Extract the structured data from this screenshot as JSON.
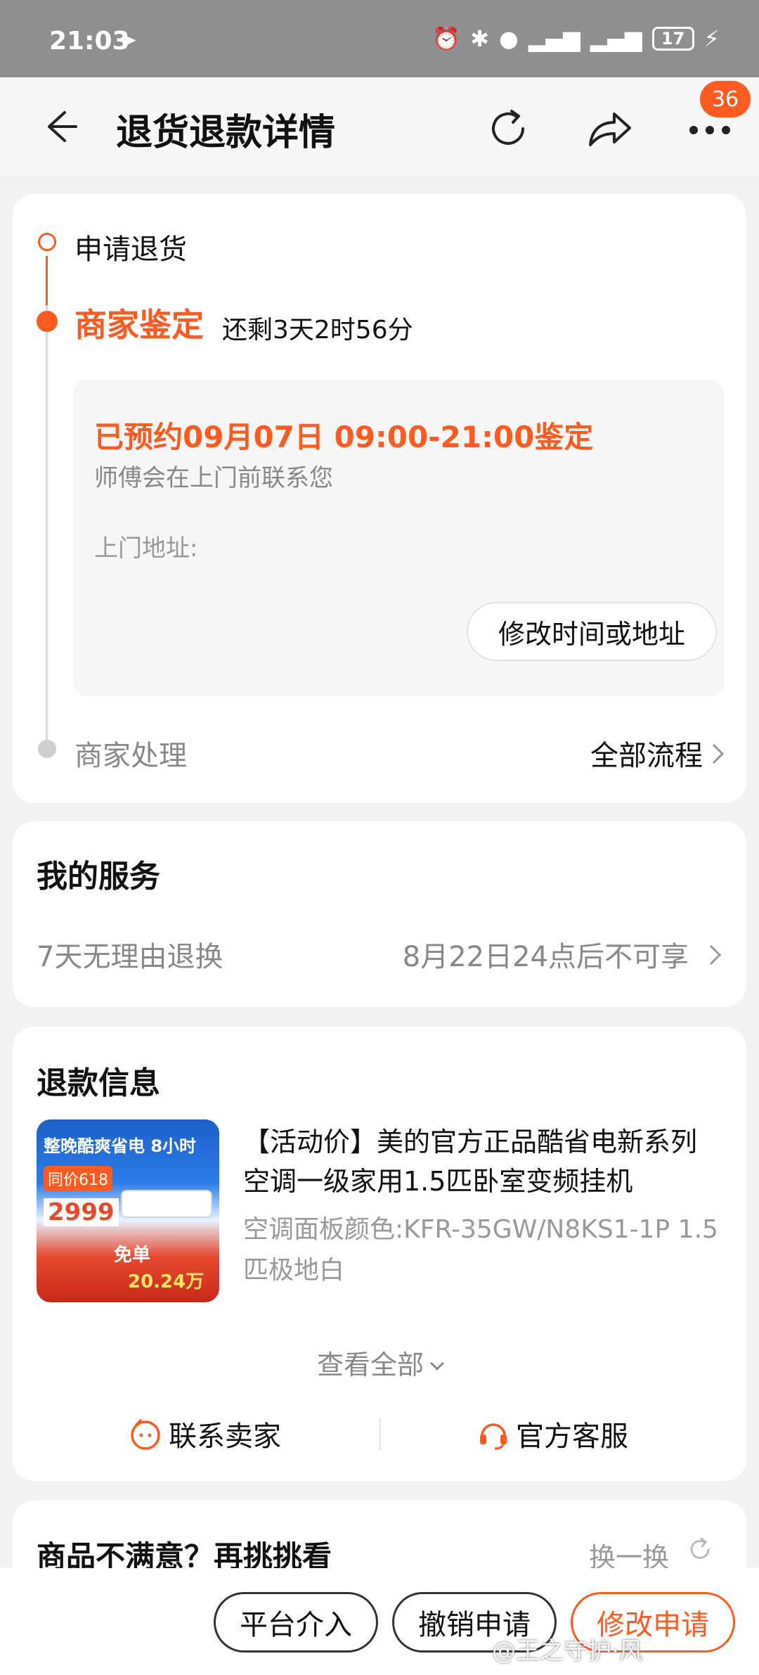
{
  "status_bar": {
    "time": "21:03",
    "battery": "17"
  },
  "header": {
    "title": "退货退款详情",
    "badge": "36"
  },
  "progress": {
    "step1": "申请退货",
    "step2": "商家鉴定",
    "step2_remaining": "还剩3天2时56分",
    "appointment": "已预约09月07日 09:00-21:00鉴定",
    "appointment_note": "师傅会在上门前联系您",
    "address_label": "上门地址:",
    "modify_button": "修改时间或地址",
    "step3": "商家处理",
    "all_flow": "全部流程"
  },
  "service": {
    "title": "我的服务",
    "name": "7天无理由退换",
    "value": "8月22日24点后不可享"
  },
  "refund": {
    "title": "退款信息",
    "product_title": "【活动价】美的官方正品酷省电新系列空调一级家用1.5匹卧室变频挂机",
    "product_spec": "空调面板颜色:KFR-35GW/N8KS1-1P 1.5匹极地白",
    "image_text": {
      "line1": "整晚酷爽省电 8小时",
      "line2": "同价618",
      "price": "2999",
      "promo": "免单",
      "amount": "20.24万"
    },
    "view_all": "查看全部",
    "contact_seller": "联系卖家",
    "official_cs": "官方客服"
  },
  "recommend": {
    "title": "商品不满意？再挑挑看",
    "refresh": "换一换"
  },
  "bottom": {
    "platform": "平台介入",
    "cancel": "撤销申请",
    "modify": "修改申请",
    "watermark": "@王之守护·风"
  },
  "colors": {
    "accent": "#ff5a1f"
  }
}
